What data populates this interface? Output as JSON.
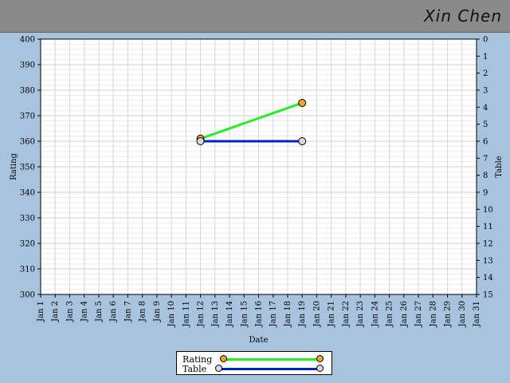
{
  "header": {
    "player_name": "Xin Chen"
  },
  "colors": {
    "background": "#a7c3dd",
    "header_background": "#8a8a8a",
    "rating_line": "#22ee22",
    "rating_marker": "#f5a623",
    "table_line": "#0022cc",
    "table_marker": "#d8d8d8"
  },
  "chart_data": {
    "type": "line",
    "xlabel": "Date",
    "ylabel": "Rating",
    "y2label": "Table",
    "x_ticks": [
      "Jan 1",
      "Jan 2",
      "Jan 3",
      "Jan 4",
      "Jan 5",
      "Jan 6",
      "Jan 7",
      "Jan 8",
      "Jan 9",
      "Jan 10",
      "Jan 11",
      "Jan 12",
      "Jan 13",
      "Jan 14",
      "Jan 15",
      "Jan 16",
      "Jan 17",
      "Jan 18",
      "Jan 19",
      "Jan 20",
      "Jan 21",
      "Jan 22",
      "Jan 23",
      "Jan 24",
      "Jan 25",
      "Jan 26",
      "Jan 27",
      "Jan 28",
      "Jan 29",
      "Jan 30",
      "Jan 31"
    ],
    "xlim": [
      1,
      31
    ],
    "ylim": [
      300,
      400
    ],
    "y_ticks": [
      300,
      310,
      320,
      330,
      340,
      350,
      360,
      370,
      380,
      390,
      400
    ],
    "y2lim": [
      0,
      15
    ],
    "y2_inverted": true,
    "y2_ticks": [
      0,
      1,
      2,
      3,
      4,
      5,
      6,
      7,
      8,
      9,
      10,
      11,
      12,
      13,
      14,
      15
    ],
    "grid": true,
    "legend_position": "bottom-center",
    "series": [
      {
        "name": "Rating",
        "axis": "left",
        "x": [
          12,
          19
        ],
        "values": [
          361,
          375
        ]
      },
      {
        "name": "Table",
        "axis": "right",
        "x": [
          12,
          19
        ],
        "values": [
          6,
          6
        ]
      }
    ]
  }
}
